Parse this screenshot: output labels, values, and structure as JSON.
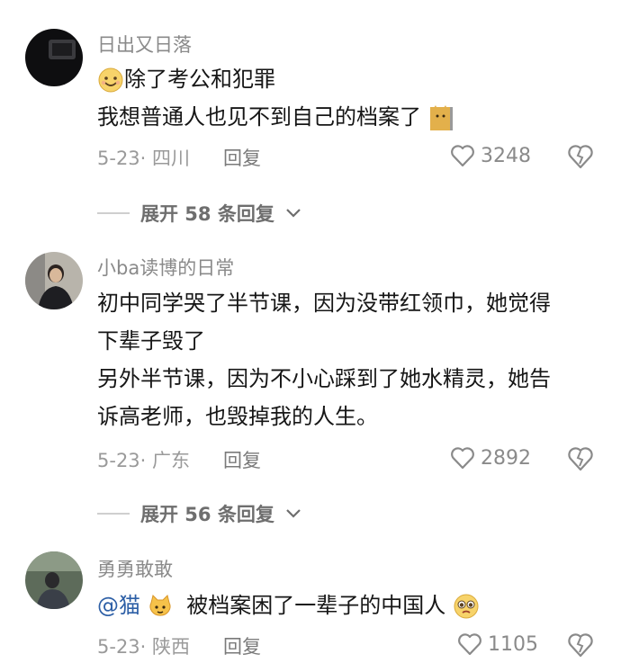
{
  "comments": [
    {
      "username": "日出又日落",
      "lines": [
        "除了考公和犯罪",
        "我想普通人也见不到自己的档案了"
      ],
      "date_location": "5-23· 四川",
      "reply_label": "回复",
      "likes": "3248",
      "expand_label": "展开 58 条回复"
    },
    {
      "username": "小ba读博的日常",
      "lines": [
        "初中同学哭了半节课，因为没带红领巾，她觉得",
        "下辈子毁了",
        "另外半节课，因为不小心踩到了她水精灵，她告",
        "诉高老师，也毁掉我的人生。"
      ],
      "date_location": "5-23· 广东",
      "reply_label": "回复",
      "likes": "2892",
      "expand_label": "展开 56 条回复"
    },
    {
      "username": "勇勇敢敢",
      "mention": "@猫",
      "lines": [
        "被档案困了一辈子的中国人"
      ],
      "date_location": "5-23· 陕西",
      "reply_label": "回复",
      "likes": "1105"
    }
  ],
  "icons": {
    "like": "heart-outline-icon",
    "dislike": "broken-heart-icon",
    "expand": "chevron-down-icon"
  },
  "colors": {
    "mention": "#2d5fa6",
    "meta": "#9a9a9a"
  }
}
